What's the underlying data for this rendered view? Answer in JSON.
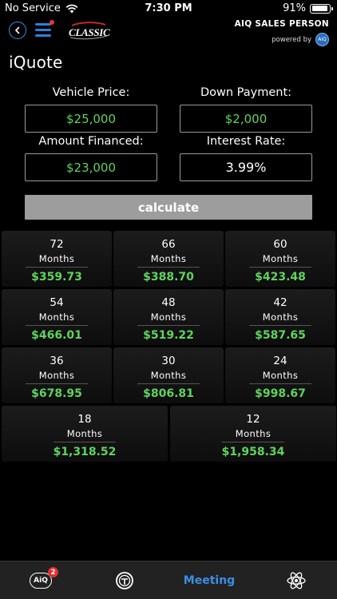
{
  "status_bar": {
    "carrier": "No Service",
    "time": "7:30 PM",
    "battery_pct": "91%",
    "battery_level": 0.91
  },
  "header": {
    "logo_text": "CLASSIC",
    "brand_title": "AIQ SALES PERSON",
    "powered_by": "powered by",
    "powered_logo": "AiQ"
  },
  "page": {
    "title": "iQuote"
  },
  "form": {
    "vehicle_price_label": "Vehicle Price:",
    "vehicle_price_value": "$25,000",
    "down_payment_label": "Down Payment:",
    "down_payment_value": "$2,000",
    "amount_financed_label": "Amount Financed:",
    "amount_financed_value": "$23,000",
    "interest_rate_label": "Interest Rate:",
    "interest_rate_value": "3.99%",
    "calculate_label": "calculate"
  },
  "terms": [
    {
      "term": "72",
      "unit": "Months",
      "payment": "$359.73"
    },
    {
      "term": "66",
      "unit": "Months",
      "payment": "$388.70"
    },
    {
      "term": "60",
      "unit": "Months",
      "payment": "$423.48"
    },
    {
      "term": "54",
      "unit": "Months",
      "payment": "$466.01"
    },
    {
      "term": "48",
      "unit": "Months",
      "payment": "$519.22"
    },
    {
      "term": "42",
      "unit": "Months",
      "payment": "$587.65"
    },
    {
      "term": "36",
      "unit": "Months",
      "payment": "$678.95"
    },
    {
      "term": "30",
      "unit": "Months",
      "payment": "$806.81"
    },
    {
      "term": "24",
      "unit": "Months",
      "payment": "$998.67"
    },
    {
      "term": "18",
      "unit": "Months",
      "payment": "$1,318.52"
    },
    {
      "term": "12",
      "unit": "Months",
      "payment": "$1,958.34"
    }
  ],
  "tab_bar": {
    "aiq_label": "AiQ",
    "aiq_badge": "2",
    "meeting_label": "Meeting",
    "active_color": "#3d8ee6"
  },
  "colors": {
    "accent_blue": "#3d8ee6",
    "money_green": "#5fd35f",
    "button_gray": "#9d9d9d"
  }
}
